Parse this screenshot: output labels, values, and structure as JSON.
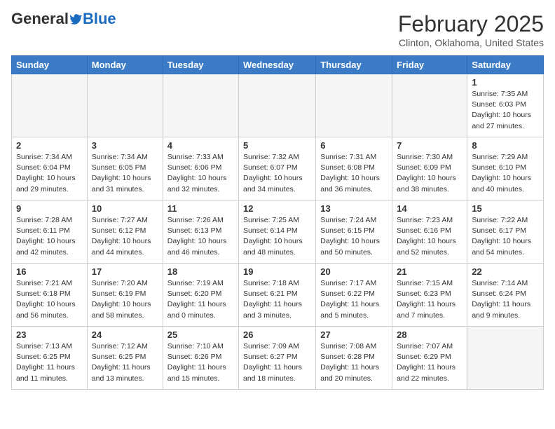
{
  "header": {
    "logo_general": "General",
    "logo_blue": "Blue",
    "month_title": "February 2025",
    "location": "Clinton, Oklahoma, United States"
  },
  "weekdays": [
    "Sunday",
    "Monday",
    "Tuesday",
    "Wednesday",
    "Thursday",
    "Friday",
    "Saturday"
  ],
  "weeks": [
    [
      {
        "day": "",
        "info": ""
      },
      {
        "day": "",
        "info": ""
      },
      {
        "day": "",
        "info": ""
      },
      {
        "day": "",
        "info": ""
      },
      {
        "day": "",
        "info": ""
      },
      {
        "day": "",
        "info": ""
      },
      {
        "day": "1",
        "info": "Sunrise: 7:35 AM\nSunset: 6:03 PM\nDaylight: 10 hours\nand 27 minutes."
      }
    ],
    [
      {
        "day": "2",
        "info": "Sunrise: 7:34 AM\nSunset: 6:04 PM\nDaylight: 10 hours\nand 29 minutes."
      },
      {
        "day": "3",
        "info": "Sunrise: 7:34 AM\nSunset: 6:05 PM\nDaylight: 10 hours\nand 31 minutes."
      },
      {
        "day": "4",
        "info": "Sunrise: 7:33 AM\nSunset: 6:06 PM\nDaylight: 10 hours\nand 32 minutes."
      },
      {
        "day": "5",
        "info": "Sunrise: 7:32 AM\nSunset: 6:07 PM\nDaylight: 10 hours\nand 34 minutes."
      },
      {
        "day": "6",
        "info": "Sunrise: 7:31 AM\nSunset: 6:08 PM\nDaylight: 10 hours\nand 36 minutes."
      },
      {
        "day": "7",
        "info": "Sunrise: 7:30 AM\nSunset: 6:09 PM\nDaylight: 10 hours\nand 38 minutes."
      },
      {
        "day": "8",
        "info": "Sunrise: 7:29 AM\nSunset: 6:10 PM\nDaylight: 10 hours\nand 40 minutes."
      }
    ],
    [
      {
        "day": "9",
        "info": "Sunrise: 7:28 AM\nSunset: 6:11 PM\nDaylight: 10 hours\nand 42 minutes."
      },
      {
        "day": "10",
        "info": "Sunrise: 7:27 AM\nSunset: 6:12 PM\nDaylight: 10 hours\nand 44 minutes."
      },
      {
        "day": "11",
        "info": "Sunrise: 7:26 AM\nSunset: 6:13 PM\nDaylight: 10 hours\nand 46 minutes."
      },
      {
        "day": "12",
        "info": "Sunrise: 7:25 AM\nSunset: 6:14 PM\nDaylight: 10 hours\nand 48 minutes."
      },
      {
        "day": "13",
        "info": "Sunrise: 7:24 AM\nSunset: 6:15 PM\nDaylight: 10 hours\nand 50 minutes."
      },
      {
        "day": "14",
        "info": "Sunrise: 7:23 AM\nSunset: 6:16 PM\nDaylight: 10 hours\nand 52 minutes."
      },
      {
        "day": "15",
        "info": "Sunrise: 7:22 AM\nSunset: 6:17 PM\nDaylight: 10 hours\nand 54 minutes."
      }
    ],
    [
      {
        "day": "16",
        "info": "Sunrise: 7:21 AM\nSunset: 6:18 PM\nDaylight: 10 hours\nand 56 minutes."
      },
      {
        "day": "17",
        "info": "Sunrise: 7:20 AM\nSunset: 6:19 PM\nDaylight: 10 hours\nand 58 minutes."
      },
      {
        "day": "18",
        "info": "Sunrise: 7:19 AM\nSunset: 6:20 PM\nDaylight: 11 hours\nand 0 minutes."
      },
      {
        "day": "19",
        "info": "Sunrise: 7:18 AM\nSunset: 6:21 PM\nDaylight: 11 hours\nand 3 minutes."
      },
      {
        "day": "20",
        "info": "Sunrise: 7:17 AM\nSunset: 6:22 PM\nDaylight: 11 hours\nand 5 minutes."
      },
      {
        "day": "21",
        "info": "Sunrise: 7:15 AM\nSunset: 6:23 PM\nDaylight: 11 hours\nand 7 minutes."
      },
      {
        "day": "22",
        "info": "Sunrise: 7:14 AM\nSunset: 6:24 PM\nDaylight: 11 hours\nand 9 minutes."
      }
    ],
    [
      {
        "day": "23",
        "info": "Sunrise: 7:13 AM\nSunset: 6:25 PM\nDaylight: 11 hours\nand 11 minutes."
      },
      {
        "day": "24",
        "info": "Sunrise: 7:12 AM\nSunset: 6:25 PM\nDaylight: 11 hours\nand 13 minutes."
      },
      {
        "day": "25",
        "info": "Sunrise: 7:10 AM\nSunset: 6:26 PM\nDaylight: 11 hours\nand 15 minutes."
      },
      {
        "day": "26",
        "info": "Sunrise: 7:09 AM\nSunset: 6:27 PM\nDaylight: 11 hours\nand 18 minutes."
      },
      {
        "day": "27",
        "info": "Sunrise: 7:08 AM\nSunset: 6:28 PM\nDaylight: 11 hours\nand 20 minutes."
      },
      {
        "day": "28",
        "info": "Sunrise: 7:07 AM\nSunset: 6:29 PM\nDaylight: 11 hours\nand 22 minutes."
      },
      {
        "day": "",
        "info": ""
      }
    ]
  ]
}
